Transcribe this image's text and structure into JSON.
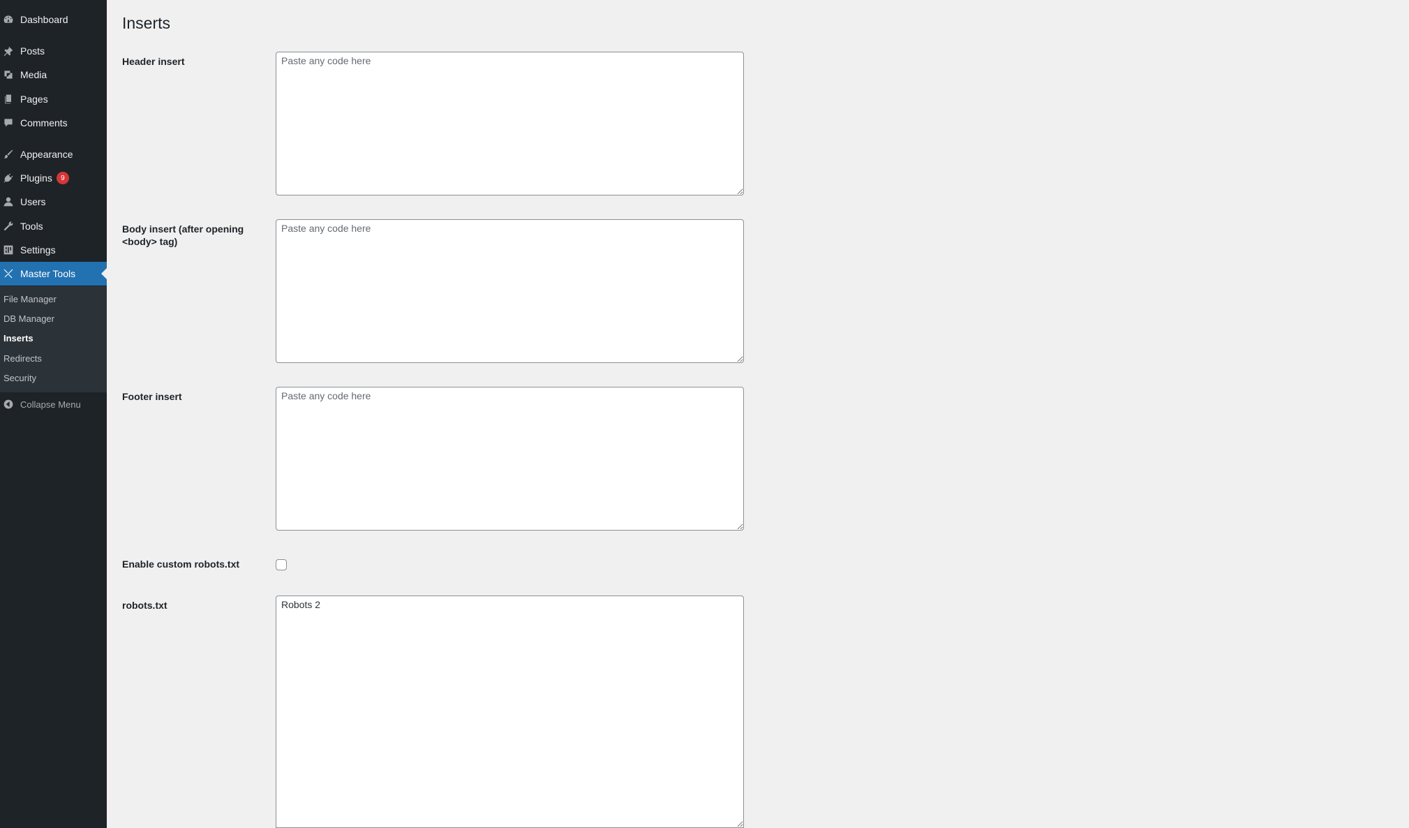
{
  "sidebar": {
    "items": [
      {
        "label": "Dashboard",
        "icon": "dashboard-icon"
      },
      {
        "label": "Posts",
        "icon": "pin-icon"
      },
      {
        "label": "Media",
        "icon": "media-icon"
      },
      {
        "label": "Pages",
        "icon": "pages-icon"
      },
      {
        "label": "Comments",
        "icon": "comment-icon"
      },
      {
        "label": "Appearance",
        "icon": "brush-icon"
      },
      {
        "label": "Plugins",
        "icon": "plugin-icon",
        "badge": "9"
      },
      {
        "label": "Users",
        "icon": "user-icon"
      },
      {
        "label": "Tools",
        "icon": "wrench-icon"
      },
      {
        "label": "Settings",
        "icon": "settings-icon"
      },
      {
        "label": "Master Tools",
        "icon": "tools-cross-icon"
      }
    ],
    "submenu": [
      "File Manager",
      "DB Manager",
      "Inserts",
      "Redirects",
      "Security"
    ],
    "collapse_label": "Collapse Menu"
  },
  "page": {
    "title": "Inserts"
  },
  "fields": {
    "header_label": "Header insert",
    "header_placeholder": "Paste any code here",
    "header_value": "",
    "body_label": "Body insert (after opening <body> tag)",
    "body_placeholder": "Paste any code here",
    "body_value": "",
    "footer_label": "Footer insert",
    "footer_placeholder": "Paste any code here",
    "footer_value": "",
    "robots_enable_label": "Enable custom robots.txt",
    "robots_label": "robots.txt",
    "robots_value": "Robots 2"
  },
  "colors": {
    "sidebar_bg": "#1d2327",
    "active_bg": "#2271b1",
    "badge_bg": "#d63638",
    "page_bg": "#f0f0f1"
  }
}
